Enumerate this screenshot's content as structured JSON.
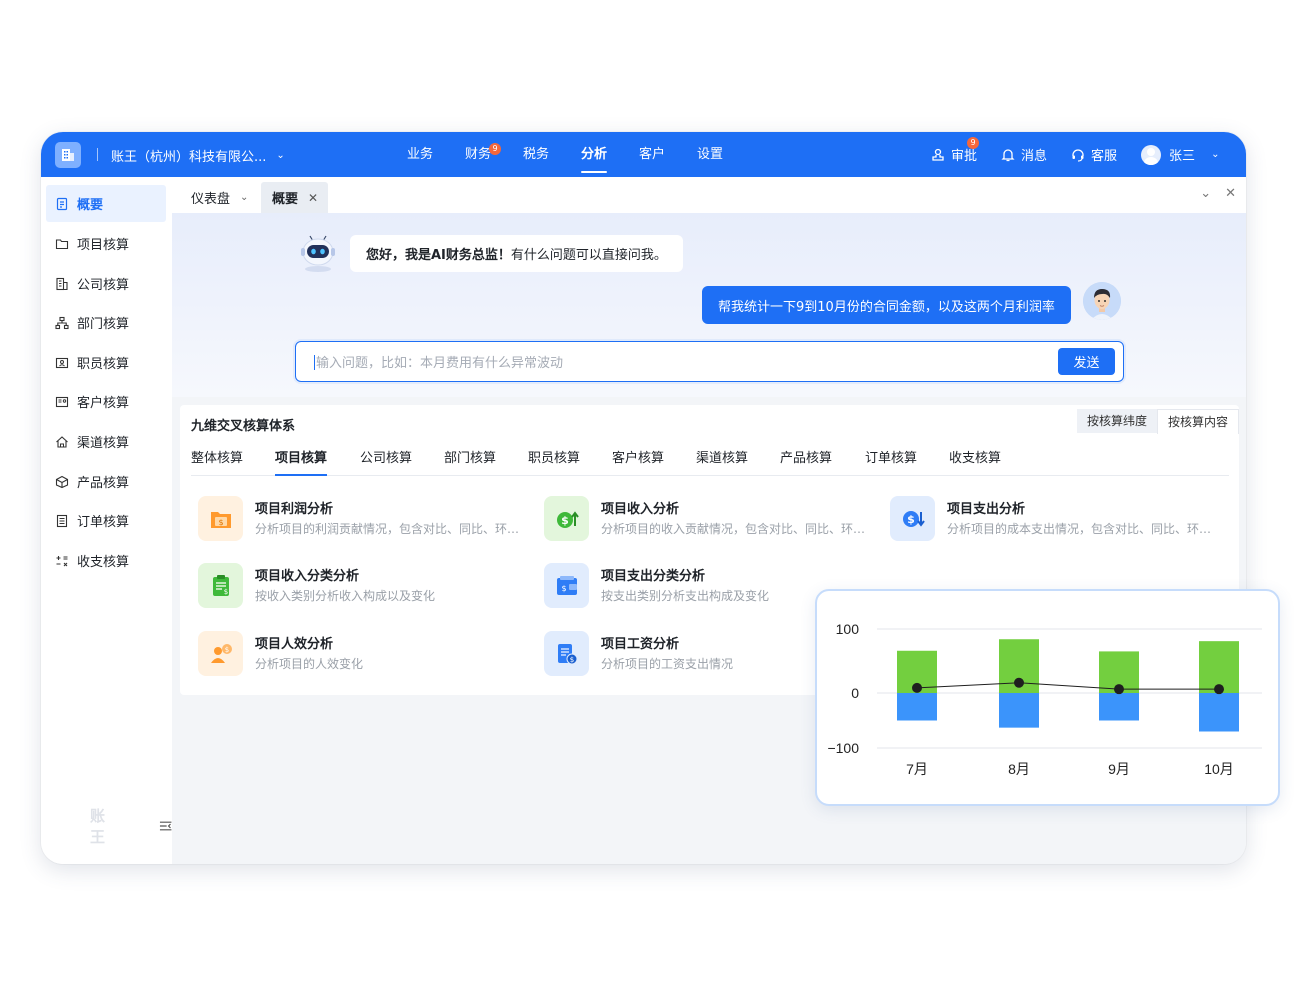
{
  "topbar": {
    "company": "账王（杭州）科技有限公...",
    "nav": [
      {
        "label": "业务"
      },
      {
        "label": "财务",
        "badge": "9"
      },
      {
        "label": "税务"
      },
      {
        "label": "分析",
        "active": true
      },
      {
        "label": "客户"
      },
      {
        "label": "设置"
      }
    ],
    "approve": {
      "label": "审批",
      "badge": "9"
    },
    "message": {
      "label": "消息"
    },
    "service": {
      "label": "客服"
    },
    "user": "张三"
  },
  "sidebar": {
    "items": [
      {
        "label": "概要",
        "icon": "doc-icon",
        "active": true
      },
      {
        "label": "项目核算",
        "icon": "folder-icon"
      },
      {
        "label": "公司核算",
        "icon": "building-icon"
      },
      {
        "label": "部门核算",
        "icon": "org-icon"
      },
      {
        "label": "职员核算",
        "icon": "id-card-icon"
      },
      {
        "label": "客户核算",
        "icon": "contact-icon"
      },
      {
        "label": "渠道核算",
        "icon": "home-icon"
      },
      {
        "label": "产品核算",
        "icon": "box-icon"
      },
      {
        "label": "订单核算",
        "icon": "list-icon"
      },
      {
        "label": "收支核算",
        "icon": "plusminus-icon"
      }
    ],
    "brand": "账王"
  },
  "tabs": {
    "dashboard": "仪表盘",
    "overview": "概要"
  },
  "chat": {
    "bot_greeting_bold": "您好，我是AI财务总监！",
    "bot_greeting_rest": "有什么问题可以直接问我。",
    "user_message": "帮我统计一下9到10月份的合同金额，以及这两个月利润率",
    "input_placeholder": "输入问题，比如：本月费用有什么异常波动",
    "send_label": "发送"
  },
  "panel": {
    "title": "九维交叉核算体系",
    "toggle": [
      "按核算纬度",
      "按核算内容"
    ],
    "toggle_active": 1,
    "subtabs": [
      "整体核算",
      "项目核算",
      "公司核算",
      "部门核算",
      "职员核算",
      "客户核算",
      "渠道核算",
      "产品核算",
      "订单核算",
      "收支核算"
    ],
    "subtab_active": 1,
    "cards": [
      {
        "title": "项目利润分析",
        "desc": "分析项目的利润贡献情况，包含对比、同比、环比等",
        "color": "#ff9a2e",
        "bg": "#fff1e0"
      },
      {
        "title": "项目收入分析",
        "desc": "分析项目的收入贡献情况，包含对比、同比、环比等",
        "color": "#3fb93a",
        "bg": "#e3f6dc"
      },
      {
        "title": "项目支出分析",
        "desc": "分析项目的成本支出情况，包含对比、同比、环比等",
        "color": "#2f7df6",
        "bg": "#e1ecfd"
      },
      {
        "title": "项目收入分类分析",
        "desc": "按收入类别分析收入构成以及变化",
        "color": "#3fb93a",
        "bg": "#e3f6dc"
      },
      {
        "title": "项目支出分类分析",
        "desc": "按支出类别分析支出构成及变化",
        "color": "#2f7df6",
        "bg": "#e1ecfd"
      },
      {
        "title": "项目人效分析",
        "desc": "分析项目的人效变化",
        "color": "#ff9a2e",
        "bg": "#fff1e0"
      },
      {
        "title": "项目工资分析",
        "desc": "分析项目的工资支出情况",
        "color": "#2f7df6",
        "bg": "#e1ecfd"
      }
    ]
  },
  "chart_data": {
    "type": "bar",
    "categories": [
      "7月",
      "8月",
      "9月",
      "10月"
    ],
    "series": [
      {
        "values": [
          66,
          84,
          65,
          81
        ],
        "color": "#73cf3f"
      },
      {
        "values": [
          -50,
          -63,
          -50,
          -70
        ],
        "color": "#3b94fb"
      },
      {
        "values": [
          8,
          16,
          6,
          6
        ],
        "color": "#1f1f1f",
        "kind": "line"
      }
    ],
    "y_ticks": [
      "100",
      "0",
      "−100"
    ],
    "ylim": [
      -100,
      100
    ],
    "grid": true
  }
}
